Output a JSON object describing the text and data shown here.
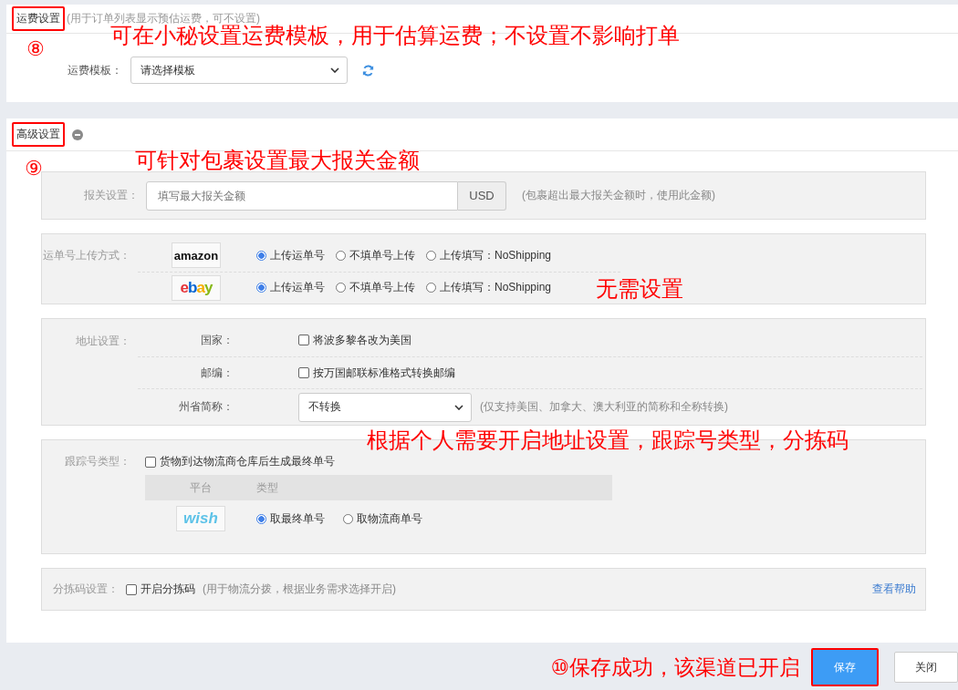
{
  "freight_section": {
    "title": "运费设置",
    "title_highlighted": true,
    "hint": "(用于订单列表显示预估运费，可不设置)",
    "marker": "⑧",
    "note": "可在小秘设置运费模板，用于估算运费；不设置不影响打单",
    "template_label": "运费模板：",
    "template_select": "请选择模板"
  },
  "advanced_section": {
    "title": "高级设置",
    "title_highlighted": true,
    "expanded": true,
    "marker": "⑨",
    "note": "可针对包裹设置最大报关金额",
    "customs": {
      "label": "报关设置：",
      "placeholder": "填写最大报关金额",
      "currency": "USD",
      "hint": "(包裹超出最大报关金额时，使用此金额)"
    },
    "upload": {
      "label": "运单号上传方式：",
      "note": "无需设置",
      "platforms": [
        {
          "kind": "amazon",
          "logo": "amazon",
          "options": [
            {
              "label": "上传运单号",
              "selected": true
            },
            {
              "label": "不填单号上传",
              "selected": false
            },
            {
              "label": "上传填写：NoShipping",
              "selected": false
            }
          ]
        },
        {
          "kind": "ebay",
          "logo": "ebay",
          "options": [
            {
              "label": "上传运单号",
              "selected": true
            },
            {
              "label": "不填单号上传",
              "selected": false
            },
            {
              "label": "上传填写：NoShipping",
              "selected": false
            }
          ]
        }
      ]
    },
    "address": {
      "label": "地址设置：",
      "note": "根据个人需要开启地址设置，跟踪号类型，分拣码",
      "rows": [
        {
          "kind": "checkbox",
          "label": "国家：",
          "text": "将波多黎各改为美国",
          "checked": false
        },
        {
          "kind": "checkbox",
          "label": "邮编：",
          "text": "按万国邮联标准格式转换邮编",
          "checked": false
        },
        {
          "kind": "select",
          "label": "州省简称：",
          "value": "不转换",
          "hint": "(仅支持美国、加拿大、澳大利亚的简称和全称转换)"
        }
      ]
    },
    "tracking": {
      "label": "跟踪号类型：",
      "checkbox_text": "货物到达物流商仓库后生成最终单号",
      "checked": false,
      "columns": [
        "平台",
        "类型"
      ],
      "platforms": [
        {
          "kind": "wish",
          "logo": "wish",
          "options": [
            {
              "label": "取最终单号",
              "selected": true
            },
            {
              "label": "取物流商单号",
              "selected": false
            }
          ]
        }
      ]
    },
    "sorting": {
      "label": "分拣码设置：",
      "checkbox_text": "开启分拣码",
      "checked": false,
      "hint": "(用于物流分拨，根据业务需求选择开启)",
      "help_link": "查看帮助"
    }
  },
  "footer": {
    "note": "⑩保存成功，该渠道已开启",
    "save": "保存",
    "save_highlighted": true,
    "close": "关闭"
  }
}
